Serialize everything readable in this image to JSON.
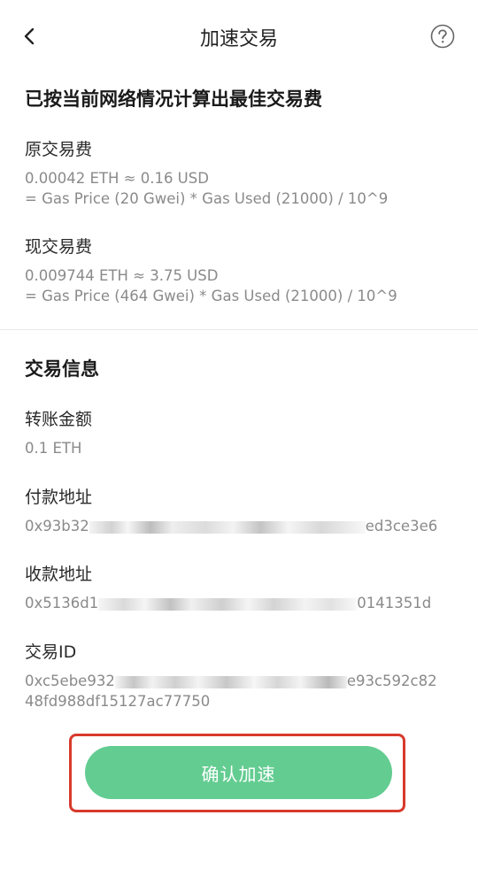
{
  "nav": {
    "title": "加速交易"
  },
  "fee": {
    "heading": "已按当前网络情况计算出最佳交易费",
    "original": {
      "label": "原交易费",
      "line1": "0.00042 ETH ≈ 0.16 USD",
      "line2": "= Gas Price (20 Gwei) * Gas Used (21000) / 10^9"
    },
    "current": {
      "label": "现交易费",
      "line1": "0.009744 ETH ≈ 3.75 USD",
      "line2": "= Gas Price (464 Gwei) * Gas Used (21000) / 10^9"
    }
  },
  "tx": {
    "heading": "交易信息",
    "amount": {
      "label": "转账金额",
      "value": "0.1 ETH"
    },
    "from": {
      "label": "付款地址",
      "prefix": "0x93b32",
      "suffix": "ed3ce3e6"
    },
    "to": {
      "label": "收款地址",
      "prefix": "0x5136d1",
      "suffix": "0141351d"
    },
    "id": {
      "label": "交易ID",
      "prefix": "0xc5ebe932",
      "suffix": "e93c592c82",
      "line2": "48fd988df15127ac77750"
    }
  },
  "confirm": {
    "label": "确认加速"
  },
  "colors": {
    "accent": "#63cc91",
    "highlight": "#d8392c"
  }
}
